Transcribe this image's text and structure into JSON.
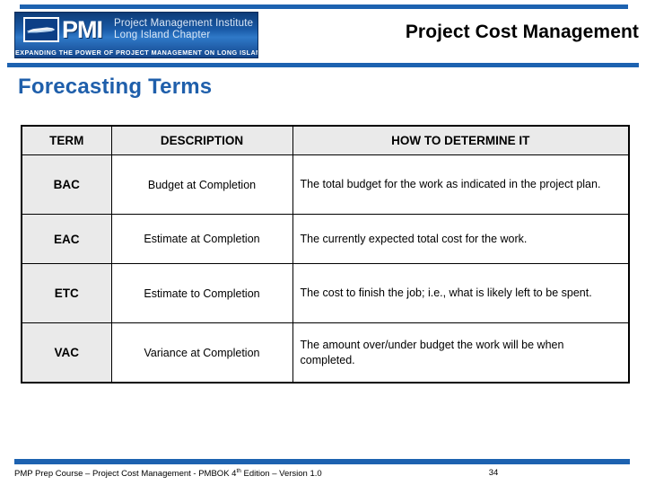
{
  "header": {
    "slide_title": "Project Cost Management",
    "logo": {
      "mark_text": "PMI",
      "org_line1": "Project Management Institute",
      "org_line2": "Long Island Chapter",
      "tagline": "Expanding the Power of Project Management on Long Island",
      "map_icon": "long-island-map-icon"
    },
    "rule_color": "#1d62b0"
  },
  "section": {
    "heading": "Forecasting Terms",
    "heading_color": "#1f5fab"
  },
  "table": {
    "headers": [
      "TERM",
      "DESCRIPTION",
      "HOW TO DETERMINE IT"
    ],
    "rows": [
      {
        "term": "BAC",
        "description": "Budget at Completion",
        "how": "The total budget for the work as indicated in the project plan."
      },
      {
        "term": "EAC",
        "description": "Estimate at Completion",
        "how": "The currently expected total cost for the work."
      },
      {
        "term": "ETC",
        "description": "Estimate to Completion",
        "how": "The cost to finish the job; i.e., what is likely left to be spent."
      },
      {
        "term": "VAC",
        "description": "Variance at Completion",
        "how": "The amount over/under budget the work will be when completed."
      }
    ],
    "header_bg": "#eaeaea",
    "term_col_bg": "#eaeaea"
  },
  "footer": {
    "text_before": "PMP Prep Course – Project Cost Management - PMBOK 4",
    "text_sup": "th",
    "text_after": " Edition – Version 1.0",
    "page_number": "34"
  }
}
